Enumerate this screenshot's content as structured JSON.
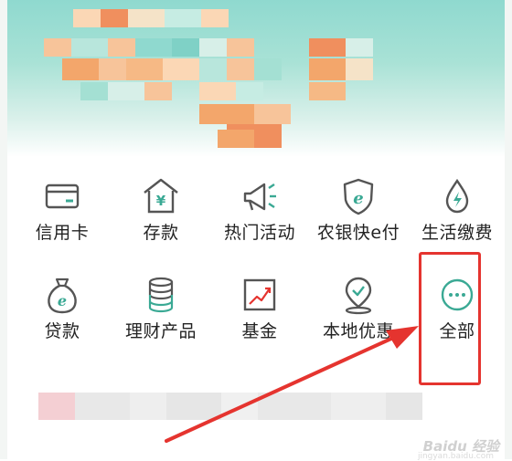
{
  "menu": {
    "row1": [
      {
        "label": "信用卡",
        "icon": "credit-card-icon"
      },
      {
        "label": "存款",
        "icon": "deposit-house-icon"
      },
      {
        "label": "热门活动",
        "icon": "megaphone-icon"
      },
      {
        "label": "农银快e付",
        "icon": "e-pay-shield-icon"
      },
      {
        "label": "生活缴费",
        "icon": "water-drop-bolt-icon"
      }
    ],
    "row2": [
      {
        "label": "贷款",
        "icon": "money-bag-icon"
      },
      {
        "label": "理财产品",
        "icon": "coin-stack-icon"
      },
      {
        "label": "基金",
        "icon": "trend-chart-icon"
      },
      {
        "label": "本地优惠",
        "icon": "location-pin-icon"
      },
      {
        "label": "全部",
        "icon": "more-dots-icon"
      }
    ]
  },
  "watermark": {
    "text": "Baidu 经验",
    "sub": "jingyan.baidu.com"
  },
  "colors": {
    "icon_teal": "#3aa994",
    "icon_gray": "#555555",
    "annotation_red": "#e5342f"
  }
}
